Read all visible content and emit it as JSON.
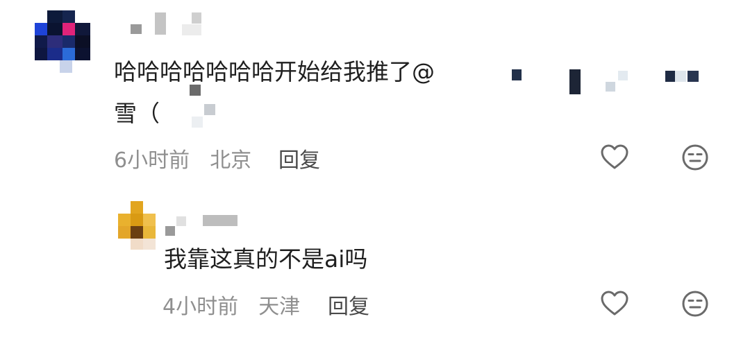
{
  "comments": [
    {
      "text_line1": "哈哈哈哈哈哈哈开始给我推了@",
      "text_line2": "雪（",
      "time": "6小时前",
      "location": "北京",
      "reply_label": "回复",
      "like_icon": "heart-outline-icon",
      "dislike_icon": "neutral-face-icon"
    },
    {
      "text": "我靠这真的不是ai吗",
      "time": "4小时前",
      "location": "天津",
      "reply_label": "回复",
      "like_icon": "heart-outline-icon",
      "dislike_icon": "neutral-face-icon"
    }
  ],
  "colors": {
    "text": "#1f1f1f",
    "meta": "#8f8f8f",
    "reply": "#4a4a4a",
    "icon": "#6a6a6a"
  }
}
